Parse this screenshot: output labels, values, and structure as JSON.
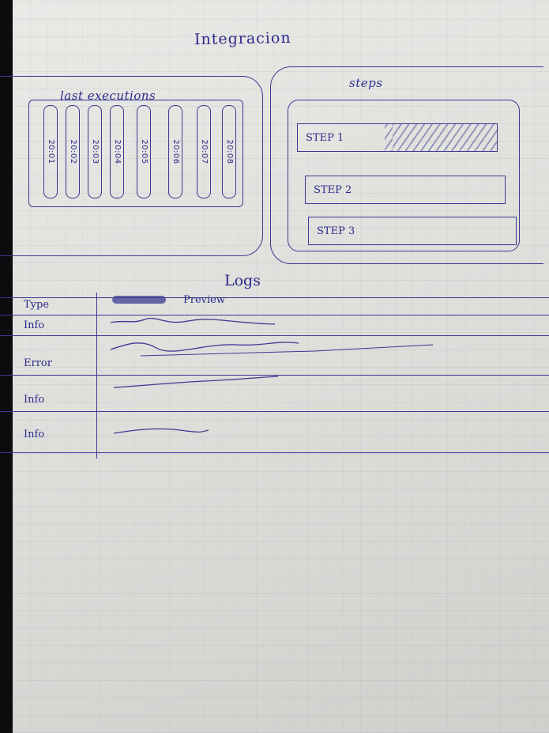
{
  "page": {
    "title": "Integracion"
  },
  "last_executions": {
    "label": "last executions",
    "items": [
      "20:01",
      "20:02",
      "20:03",
      "20:04",
      "20:05",
      "20:06",
      "20:07",
      "20:08"
    ]
  },
  "steps": {
    "label": "steps",
    "items": [
      {
        "label": "STEP 1",
        "active": true
      },
      {
        "label": "STEP 2",
        "active": false
      },
      {
        "label": "STEP 3",
        "active": false
      }
    ]
  },
  "logs": {
    "title": "Logs",
    "columns": {
      "type": "Type",
      "preview": "Preview"
    },
    "rows": [
      {
        "type": "Info"
      },
      {
        "type": "Error"
      },
      {
        "type": "Info"
      },
      {
        "type": "Info"
      }
    ]
  },
  "colors": {
    "ink": "#2c2a8a",
    "paper": "#e3e3e0"
  }
}
